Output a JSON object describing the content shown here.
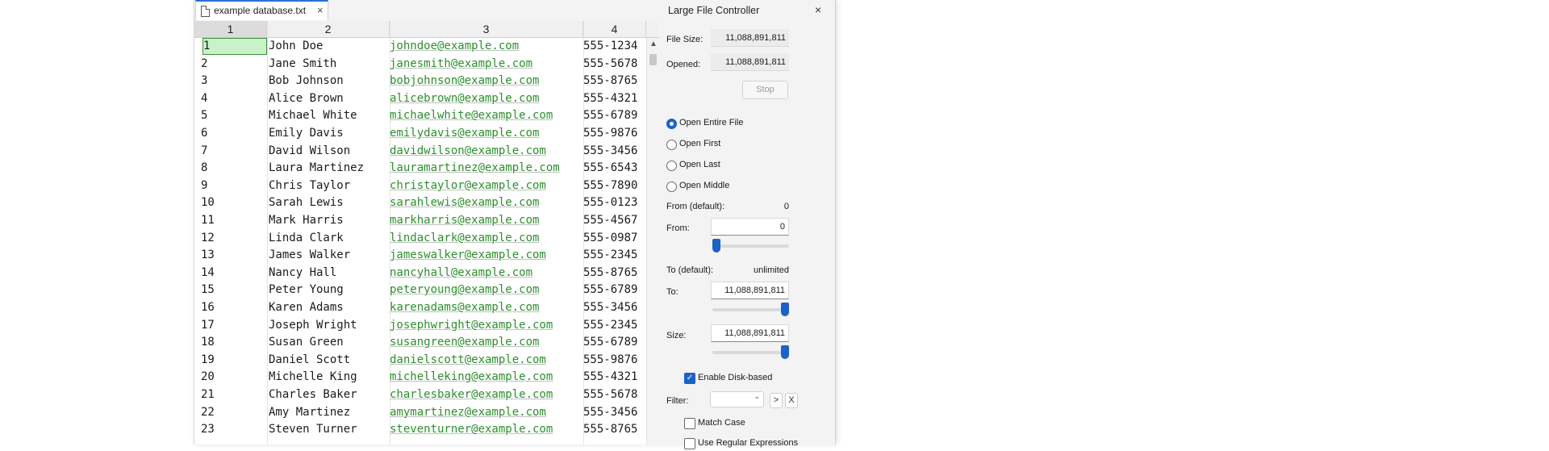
{
  "tab": {
    "title": "example database.txt",
    "close": "×"
  },
  "columns": [
    "1",
    "2",
    "3",
    "4"
  ],
  "rows": [
    [
      "1",
      "John Doe",
      "johndoe@example.com",
      "555-1234"
    ],
    [
      "2",
      "Jane Smith",
      "janesmith@example.com",
      "555-5678"
    ],
    [
      "3",
      "Bob Johnson",
      "bobjohnson@example.com",
      "555-8765"
    ],
    [
      "4",
      "Alice Brown",
      "alicebrown@example.com",
      "555-4321"
    ],
    [
      "5",
      "Michael White",
      "michaelwhite@example.com",
      "555-6789"
    ],
    [
      "6",
      "Emily Davis",
      "emilydavis@example.com",
      "555-9876"
    ],
    [
      "7",
      "David Wilson",
      "davidwilson@example.com",
      "555-3456"
    ],
    [
      "8",
      "Laura Martinez",
      "lauramartinez@example.com",
      "555-6543"
    ],
    [
      "9",
      "Chris Taylor",
      "christaylor@example.com",
      "555-7890"
    ],
    [
      "10",
      "Sarah Lewis",
      "sarahlewis@example.com",
      "555-0123"
    ],
    [
      "11",
      "Mark Harris",
      "markharris@example.com",
      "555-4567"
    ],
    [
      "12",
      "Linda Clark",
      "lindaclark@example.com",
      "555-0987"
    ],
    [
      "13",
      "James Walker",
      "jameswalker@example.com",
      "555-2345"
    ],
    [
      "14",
      "Nancy Hall",
      "nancyhall@example.com",
      "555-8765"
    ],
    [
      "15",
      "Peter Young",
      "peteryoung@example.com",
      "555-6789"
    ],
    [
      "16",
      "Karen Adams",
      "karenadams@example.com",
      "555-3456"
    ],
    [
      "17",
      "Joseph Wright",
      "josephwright@example.com",
      "555-2345"
    ],
    [
      "18",
      "Susan Green",
      "susangreen@example.com",
      "555-6789"
    ],
    [
      "19",
      "Daniel Scott",
      "danielscott@example.com",
      "555-9876"
    ],
    [
      "20",
      "Michelle King",
      "michelleking@example.com",
      "555-4321"
    ],
    [
      "21",
      "Charles Baker",
      "charlesbaker@example.com",
      "555-5678"
    ],
    [
      "22",
      "Amy Martinez",
      "amymartinez@example.com",
      "555-3456"
    ],
    [
      "23",
      "Steven Turner",
      "steventurner@example.com",
      "555-8765"
    ]
  ],
  "panel": {
    "title": "Large File Controller",
    "close": "×",
    "file_size_label": "File Size:",
    "file_size": "11,088,891,811",
    "opened_label": "Opened:",
    "opened": "11,088,891,811",
    "stop": "Stop",
    "radios": [
      {
        "label": "Open Entire File",
        "checked": true
      },
      {
        "label": "Open First",
        "checked": false
      },
      {
        "label": "Open Last",
        "checked": false
      },
      {
        "label": "Open Middle",
        "checked": false
      }
    ],
    "from_default_label": "From (default):",
    "from_default": "0",
    "from_label": "From:",
    "from_value": "0",
    "from_slider_fraction": 0,
    "to_default_label": "To (default):",
    "to_default": "unlimited",
    "to_label": "To:",
    "to_value": "11,088,891,811",
    "to_slider_fraction": 1,
    "size_label": "Size:",
    "size_value": "11,088,891,811",
    "size_slider_fraction": 1,
    "enable_disk_label": "Enable Disk-based",
    "enable_disk_checked": true,
    "filter_label": "Filter:",
    "filter_go": ">",
    "filter_clear": "X",
    "match_case_label": "Match Case",
    "regex_label": "Use Regular Expressions"
  },
  "colors": {
    "accent": "#1a62c8",
    "email": "#2c8f2c",
    "selected_cell": "#c9f2c9"
  }
}
